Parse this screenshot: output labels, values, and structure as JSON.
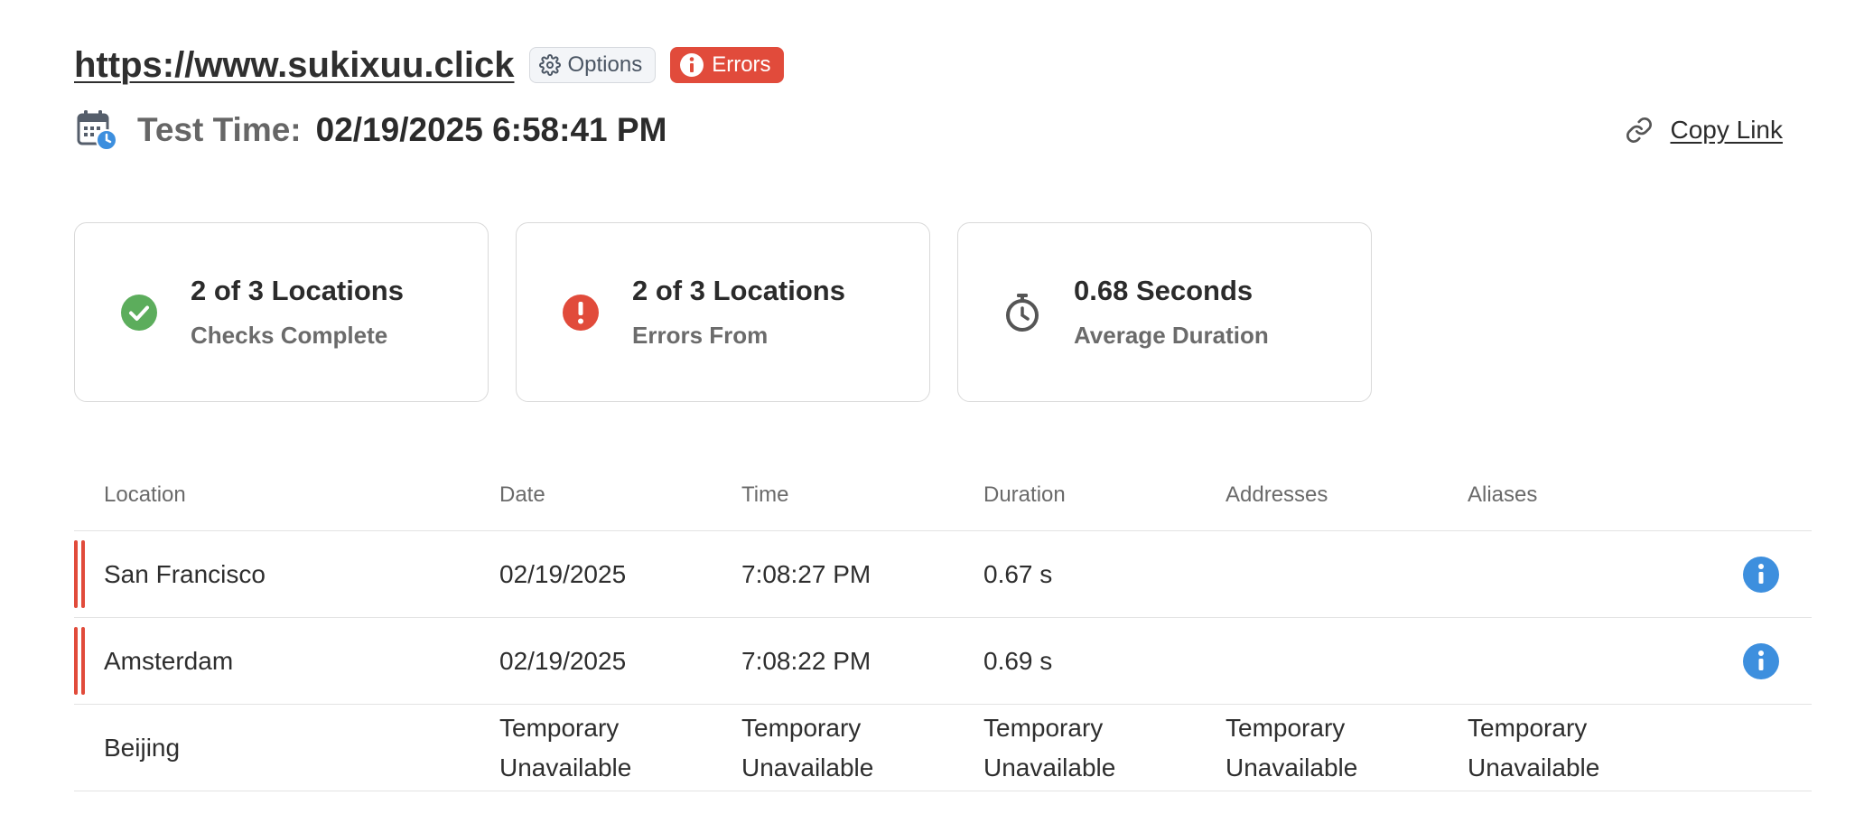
{
  "header": {
    "url": "https://www.sukixuu.click",
    "options_label": "Options",
    "errors_label": "Errors"
  },
  "test_time": {
    "label": "Test Time:",
    "value": "02/19/2025 6:58:41 PM"
  },
  "copy_link": {
    "label": "Copy Link"
  },
  "cards": [
    {
      "title": "2 of 3 Locations",
      "subtitle": "Checks Complete",
      "icon": "check-circle-icon",
      "color": "#5cad5c"
    },
    {
      "title": "2 of 3 Locations",
      "subtitle": "Errors From",
      "icon": "alert-circle-icon",
      "color": "#e14b3b"
    },
    {
      "title": "0.68 Seconds",
      "subtitle": "Average Duration",
      "icon": "stopwatch-icon",
      "color": "#555555"
    }
  ],
  "table": {
    "columns": [
      "Location",
      "Date",
      "Time",
      "Duration",
      "Addresses",
      "Aliases"
    ],
    "rows": [
      {
        "location": "San Francisco",
        "date": "02/19/2025",
        "time": "7:08:27 PM",
        "duration": "0.67 s",
        "addresses": "",
        "aliases": "",
        "error": true
      },
      {
        "location": "Amsterdam",
        "date": "02/19/2025",
        "time": "7:08:22 PM",
        "duration": "0.69 s",
        "addresses": "",
        "aliases": "",
        "error": true
      },
      {
        "location": "Beijing",
        "date": "Temporary Unavailable",
        "time": "Temporary Unavailable",
        "duration": "Temporary Unavailable",
        "addresses": "Temporary Unavailable",
        "aliases": "Temporary Unavailable",
        "error": false
      }
    ]
  },
  "colors": {
    "error": "#e14b3b",
    "success": "#5cad5c",
    "info": "#3d8fde"
  }
}
